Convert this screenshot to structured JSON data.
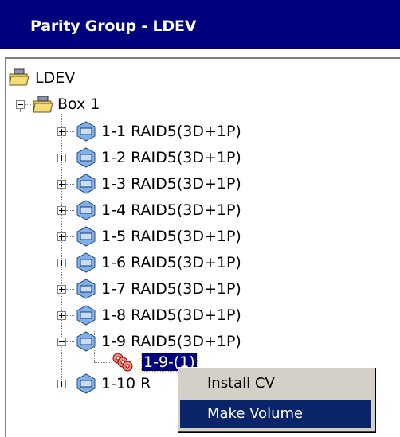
{
  "header": {
    "title": "Parity Group - LDEV"
  },
  "tree": {
    "root_label": "LDEV",
    "box_label": "Box 1",
    "groups": [
      "1-1 RAID5(3D+1P)",
      "1-2 RAID5(3D+1P)",
      "1-3 RAID5(3D+1P)",
      "1-4 RAID5(3D+1P)",
      "1-5 RAID5(3D+1P)",
      "1-6 RAID5(3D+1P)",
      "1-7 RAID5(3D+1P)",
      "1-8 RAID5(3D+1P)",
      "1-9 RAID5(3D+1P)"
    ],
    "child_label": "1-9-(1)",
    "last_group": "1-10 R"
  },
  "context_menu": {
    "items": [
      "Install CV",
      "Make Volume"
    ],
    "highlighted": "Make Volume"
  },
  "colors": {
    "header_bg": "#00007f",
    "selection_bg": "#0a246a",
    "menu_bg": "#d4d0c8"
  }
}
